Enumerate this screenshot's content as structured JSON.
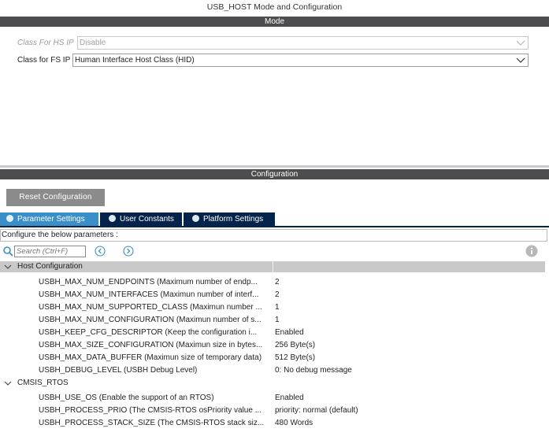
{
  "window": {
    "title": "USB_HOST Mode and Configuration"
  },
  "mode_section": {
    "header": "Mode",
    "fields": [
      {
        "label": "Class For HS IP",
        "value": "Disable",
        "disabled": true
      },
      {
        "label": "Class for FS IP",
        "value": "Human Interface Host Class (HID)",
        "disabled": false
      }
    ]
  },
  "config_section": {
    "header": "Configuration",
    "reset_button": "Reset Configuration",
    "tabs": [
      {
        "label": "Parameter Settings",
        "active": true
      },
      {
        "label": "User Constants",
        "active": false
      },
      {
        "label": "Platform Settings",
        "active": false
      }
    ],
    "instructions": "Configure the below parameters :",
    "search": {
      "placeholder": "Search (Ctrl+F)"
    },
    "groups": [
      {
        "name": "Host Configuration",
        "params": [
          {
            "name": "USBH_MAX_NUM_ENDPOINTS (Maximum number of endp...",
            "value": "2"
          },
          {
            "name": "USBH_MAX_NUM_INTERFACES (Maximun number of interf...",
            "value": "2"
          },
          {
            "name": "USBH_MAX_NUM_SUPPORTED_CLASS (Maximun number ...",
            "value": "1"
          },
          {
            "name": "USBH_MAX_NUM_CONFIGURATION (Maximun number of s...",
            "value": "1"
          },
          {
            "name": "USBH_KEEP_CFG_DESCRIPTOR (Keep the configuration i...",
            "value": "Enabled"
          },
          {
            "name": "USBH_MAX_SIZE_CONFIGURATION (Maximun size in bytes...",
            "value": "256 Byte(s)"
          },
          {
            "name": "USBH_MAX_DATA_BUFFER (Maximun size of temporary data)",
            "value": "512 Byte(s)"
          },
          {
            "name": "USBH_DEBUG_LEVEL (USBH Debug Level)",
            "value": "0: No debug message"
          }
        ]
      },
      {
        "name": "CMSIS_RTOS",
        "params": [
          {
            "name": "USBH_USE_OS (Enable the support of an RTOS)",
            "value": "Enabled"
          },
          {
            "name": "USBH_PROCESS_PRIO (The CMSIS-RTOS osPriority value ...",
            "value": "priority: normal (default)"
          },
          {
            "name": "USBH_PROCESS_STACK_SIZE (The CMSIS-RTOS stack siz...",
            "value": "480 Words"
          }
        ]
      }
    ]
  },
  "colors": {
    "section_bar": "#4d4d4f",
    "tab_active": "#3b8fc8",
    "tab_inactive": "#03234b",
    "button": "#8b8b8b",
    "nav_icon": "#3b8fc8"
  },
  "icons": [
    "chevron-down-icon",
    "check-circle-icon",
    "search-icon",
    "arrow-left-icon",
    "arrow-right-icon",
    "info-icon",
    "collapse-arrow-icon"
  ]
}
